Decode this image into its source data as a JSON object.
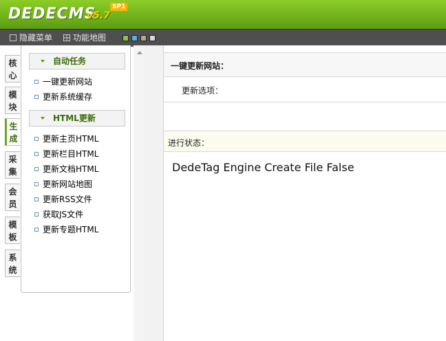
{
  "header": {
    "logo_text": "DEDECMS",
    "version": "v5.7",
    "sp_badge": "SP1"
  },
  "toolbar": {
    "hide_menu": "隐藏菜单",
    "site_map": "功能地图",
    "swatches": [
      "#8bc34a",
      "#5ab0e0",
      "#b8a98a",
      "#d9d9d9"
    ]
  },
  "tabs": [
    "核心",
    "模块",
    "生成",
    "采集",
    "会员",
    "模板",
    "系统"
  ],
  "active_tab": "生成",
  "menu": {
    "section1": {
      "title": "自动任务",
      "items": [
        "一键更新网站",
        "更新系统缓存"
      ]
    },
    "section2": {
      "title": "HTML更新",
      "items": [
        "更新主页HTML",
        "更新栏目HTML",
        "更新文档HTML",
        "更新网站地图",
        "更新RSS文件",
        "获取JS文件",
        "更新专题HTML"
      ]
    }
  },
  "main": {
    "title": "一键更新网站：",
    "options_label": "更新选项：",
    "status_label": "进行状态：",
    "status_message": "DedeTag Engine Create File False"
  },
  "colors": {
    "header_green": "#6aa41a",
    "toolbar_gray": "#4f4f4f",
    "accent_text": "#3a6b08"
  }
}
